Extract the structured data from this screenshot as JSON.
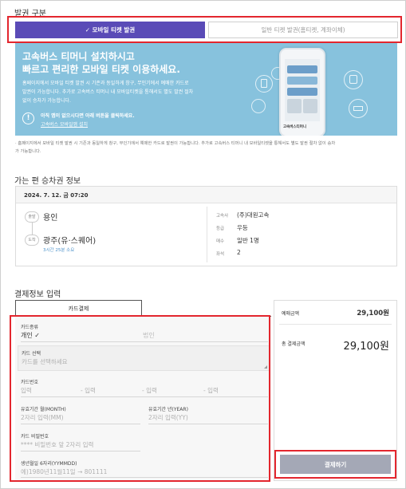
{
  "ticket_type": {
    "section_title": "발권 구분",
    "mobile_tab": "✓ 모바일 티켓 발권",
    "general_tab": "일반 티켓 발권(홈티켓, 계좌이체)"
  },
  "banner": {
    "headline_1": "고속버스 티머니 설치하시고",
    "headline_2": "빠르고 편리한 모바일 티켓 이용하세요.",
    "desc_1": "홈페이지에서 모바일 티켓 발권 시 기존과 동일하게 창구, 무인기에서 예매한 카드로",
    "desc_2": "발권이 가능합니다. 추가로 고속버스 티머니 내 모바일티켓을 통해서도 별도 발권 절차",
    "desc_3": "없이 승차가 가능합니다.",
    "app_notice": "아직 앱이 없으시다면 아래 버튼을 클릭하세요.",
    "app_link": "고속버스 모바일앱 설치",
    "phone_caption": "고속버스티머니"
  },
  "notice": {
    "line_1": "· 홈페이지에서 모바일 티켓 발권 시 기존과 동일하게 창구, 무인기에서 예매한 카드로 발권이 가능합니다. 추가로 고속버스 티머니 내 모바일티켓을 통해서도 별도 발권 절차 없이 승차",
    "line_2": "가 가능합니다."
  },
  "trip": {
    "section_title": "가는 편 승차권 정보",
    "datetime": "2024. 7. 12. 금 07:20",
    "dep_badge": "출발",
    "dep_name": "용인",
    "arr_badge": "도착",
    "arr_name": "광주(유·스퀘어)",
    "duration": "3시간 25분 소요",
    "details": [
      {
        "k": "고속사",
        "v": "(주)대원고속"
      },
      {
        "k": "등급",
        "v": "우등"
      },
      {
        "k": "매수",
        "v": "일반 1명"
      },
      {
        "k": "좌석",
        "v": "2"
      }
    ]
  },
  "payment": {
    "section_title": "결제정보 입력",
    "tab_card": "카드결제",
    "card_type_label": "카드종류",
    "card_type_personal": "개인 ✓",
    "card_type_corporate": "법인",
    "card_select_label": "카드 선택",
    "card_select_placeholder": "카드를 선택하세요",
    "card_number_label": "카드번호",
    "card_number_ph": [
      "입력",
      "- 입력",
      "- 입력",
      "- 입력"
    ],
    "expiry_month_label": "유효기간 월(MONTH)",
    "expiry_month_ph": "2자리 입력(MM)",
    "expiry_year_label": "유효기간 년(YEAR)",
    "expiry_year_ph": "2자리 입력(YY)",
    "pin_label": "카드 비밀번호",
    "pin_ph": "**** 비밀번호 앞 2자리 입력",
    "birth_label": "생년월일 6자리(YYMMDD)",
    "birth_ph": "예)1980년11월11일 → 801111"
  },
  "summary": {
    "reserve_label": "예매금액",
    "reserve_amount": "29,100원",
    "total_label": "총 결제금액",
    "total_amount": "29,100원",
    "pay_button": "결제하기"
  },
  "colors": {
    "accent_purple": "#5a4bb7",
    "banner_blue": "#87c2dd",
    "highlight_red": "#e3262e",
    "pay_button_gray": "#a4a8b6"
  }
}
